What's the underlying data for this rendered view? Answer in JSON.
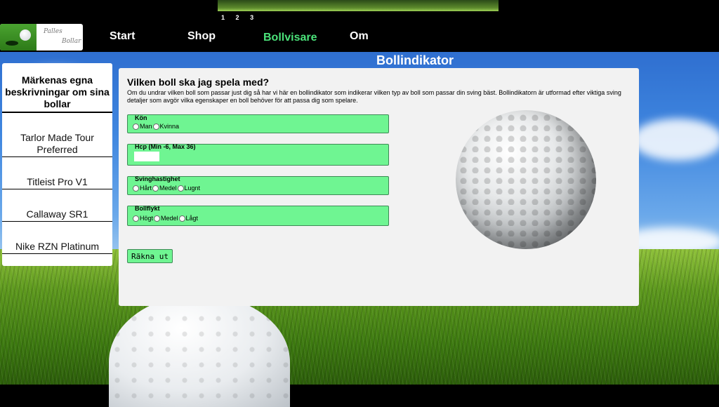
{
  "header": {
    "slides": [
      "1",
      "2",
      "3"
    ],
    "logo_text": [
      "Palles",
      "Bollar"
    ]
  },
  "nav": {
    "items": [
      {
        "label": "Start"
      },
      {
        "label": "Shop"
      },
      {
        "label": "Bollvisare",
        "active": true
      },
      {
        "label": "Om"
      }
    ]
  },
  "page": {
    "heading": "Bollindikator"
  },
  "sidebar": {
    "title": "Märkenas egna beskrivningar om sina bollar",
    "items": [
      {
        "label": "Tarlor Made Tour Preferred"
      },
      {
        "label": "Titleist Pro V1"
      },
      {
        "label": "Callaway SR1"
      },
      {
        "label": "Nike RZN Platinum"
      }
    ]
  },
  "form": {
    "title": "Vilken boll ska jag spela med?",
    "description": "Om du undrar vilken boll som passar just dig så har vi här en bollindikator som indikerar vilken typ av boll som passar din sving bäst. Bollindikatorn är utformad efter viktiga sving detaljer som avgör vilka egenskaper en boll behöver för att passa dig som spelare.",
    "gender": {
      "legend": "Kön",
      "options": [
        "Man",
        "Kvinna"
      ]
    },
    "hcp": {
      "legend": "Hcp (Min -6, Max 36)",
      "value": ""
    },
    "swing_speed": {
      "legend": "Svinghastighet",
      "options": [
        "Hårt",
        "Medel",
        "Lugnt"
      ]
    },
    "ball_flight": {
      "legend": "Bollflykt",
      "options": [
        "Högt",
        "Medel",
        "Lågt"
      ]
    },
    "submit_label": "Räkna ut"
  }
}
